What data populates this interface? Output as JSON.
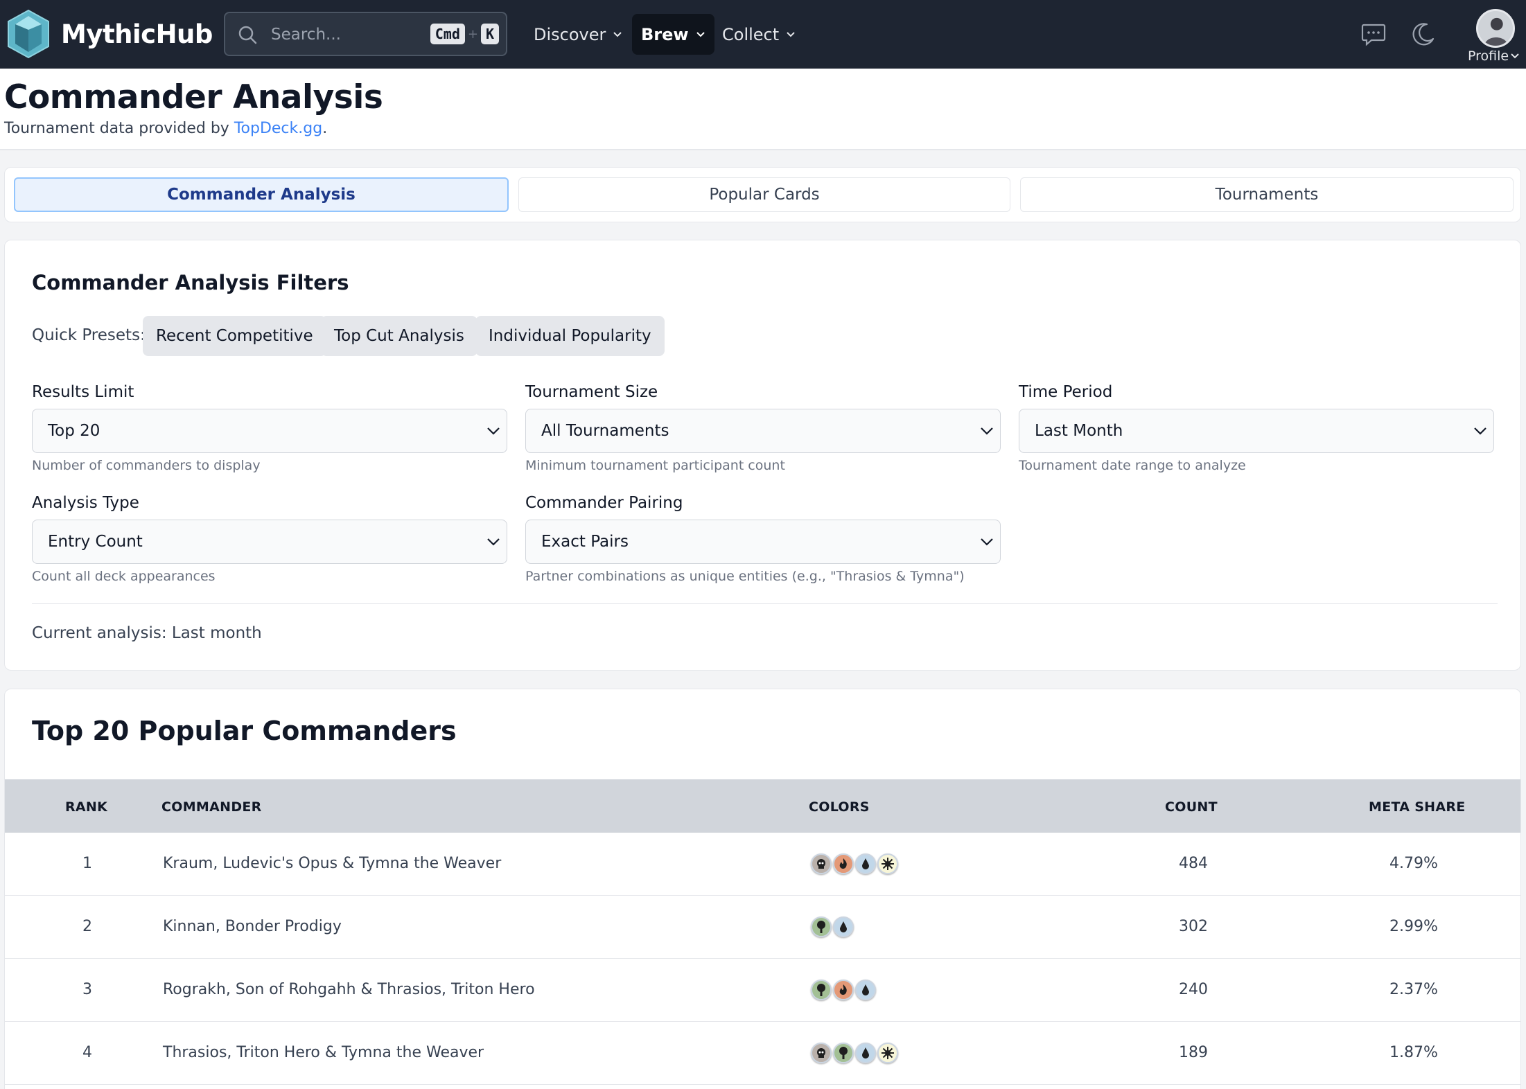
{
  "navbar": {
    "brand": "MythicHub",
    "search": {
      "placeholder": "Search...",
      "shortcut_mod": "Cmd",
      "shortcut_plus": "+",
      "shortcut_key": "K"
    },
    "items": [
      {
        "label": "Discover",
        "active": false
      },
      {
        "label": "Brew",
        "active": true
      },
      {
        "label": "Collect",
        "active": false
      }
    ],
    "icons": [
      "chat-icon",
      "moon-icon"
    ],
    "profile_label": "Profile"
  },
  "header": {
    "title": "Commander Analysis",
    "subtitle_prefix": "Tournament data provided by ",
    "subtitle_link": "TopDeck.gg",
    "subtitle_suffix": "."
  },
  "tabs": [
    {
      "label": "Commander Analysis",
      "active": true
    },
    {
      "label": "Popular Cards",
      "active": false
    },
    {
      "label": "Tournaments",
      "active": false
    }
  ],
  "filters": {
    "title": "Commander Analysis Filters",
    "presets_label": "Quick Presets:",
    "presets": [
      "Recent Competitive",
      "Top Cut Analysis",
      "Individual Popularity"
    ],
    "fields": [
      {
        "label": "Results Limit",
        "value": "Top 20",
        "helper": "Number of commanders to display"
      },
      {
        "label": "Tournament Size",
        "value": "All Tournaments",
        "helper": "Minimum tournament participant count"
      },
      {
        "label": "Time Period",
        "value": "Last Month",
        "helper": "Tournament date range to analyze"
      },
      {
        "label": "Analysis Type",
        "value": "Entry Count",
        "helper": "Count all deck appearances"
      },
      {
        "label": "Commander Pairing",
        "value": "Exact Pairs",
        "helper": "Partner combinations as unique entities (e.g., \"Thrasios & Tymna\")"
      }
    ],
    "current_analysis": "Current analysis: Last month"
  },
  "results": {
    "title": "Top 20 Popular Commanders",
    "columns": [
      "RANK",
      "COMMANDER",
      "COLORS",
      "COUNT",
      "META SHARE"
    ],
    "rows": [
      {
        "rank": "1",
        "commander": "Kraum, Ludevic's Opus & Tymna the Weaver",
        "colors": [
          "black",
          "red",
          "blue",
          "white"
        ],
        "count": "484",
        "share": "4.79%"
      },
      {
        "rank": "2",
        "commander": "Kinnan, Bonder Prodigy",
        "colors": [
          "green",
          "blue"
        ],
        "count": "302",
        "share": "2.99%"
      },
      {
        "rank": "3",
        "commander": "Rograkh, Son of Rohgahh & Thrasios, Triton Hero",
        "colors": [
          "green",
          "red",
          "blue"
        ],
        "count": "240",
        "share": "2.37%"
      },
      {
        "rank": "4",
        "commander": "Thrasios, Triton Hero & Tymna the Weaver",
        "colors": [
          "black",
          "green",
          "blue",
          "white"
        ],
        "count": "189",
        "share": "1.87%"
      }
    ]
  },
  "mana_colors": {
    "white": "#f8f6d8",
    "blue": "#c1d7e9",
    "black": "#bab1ab",
    "red": "#e49977",
    "green": "#a3c095"
  }
}
